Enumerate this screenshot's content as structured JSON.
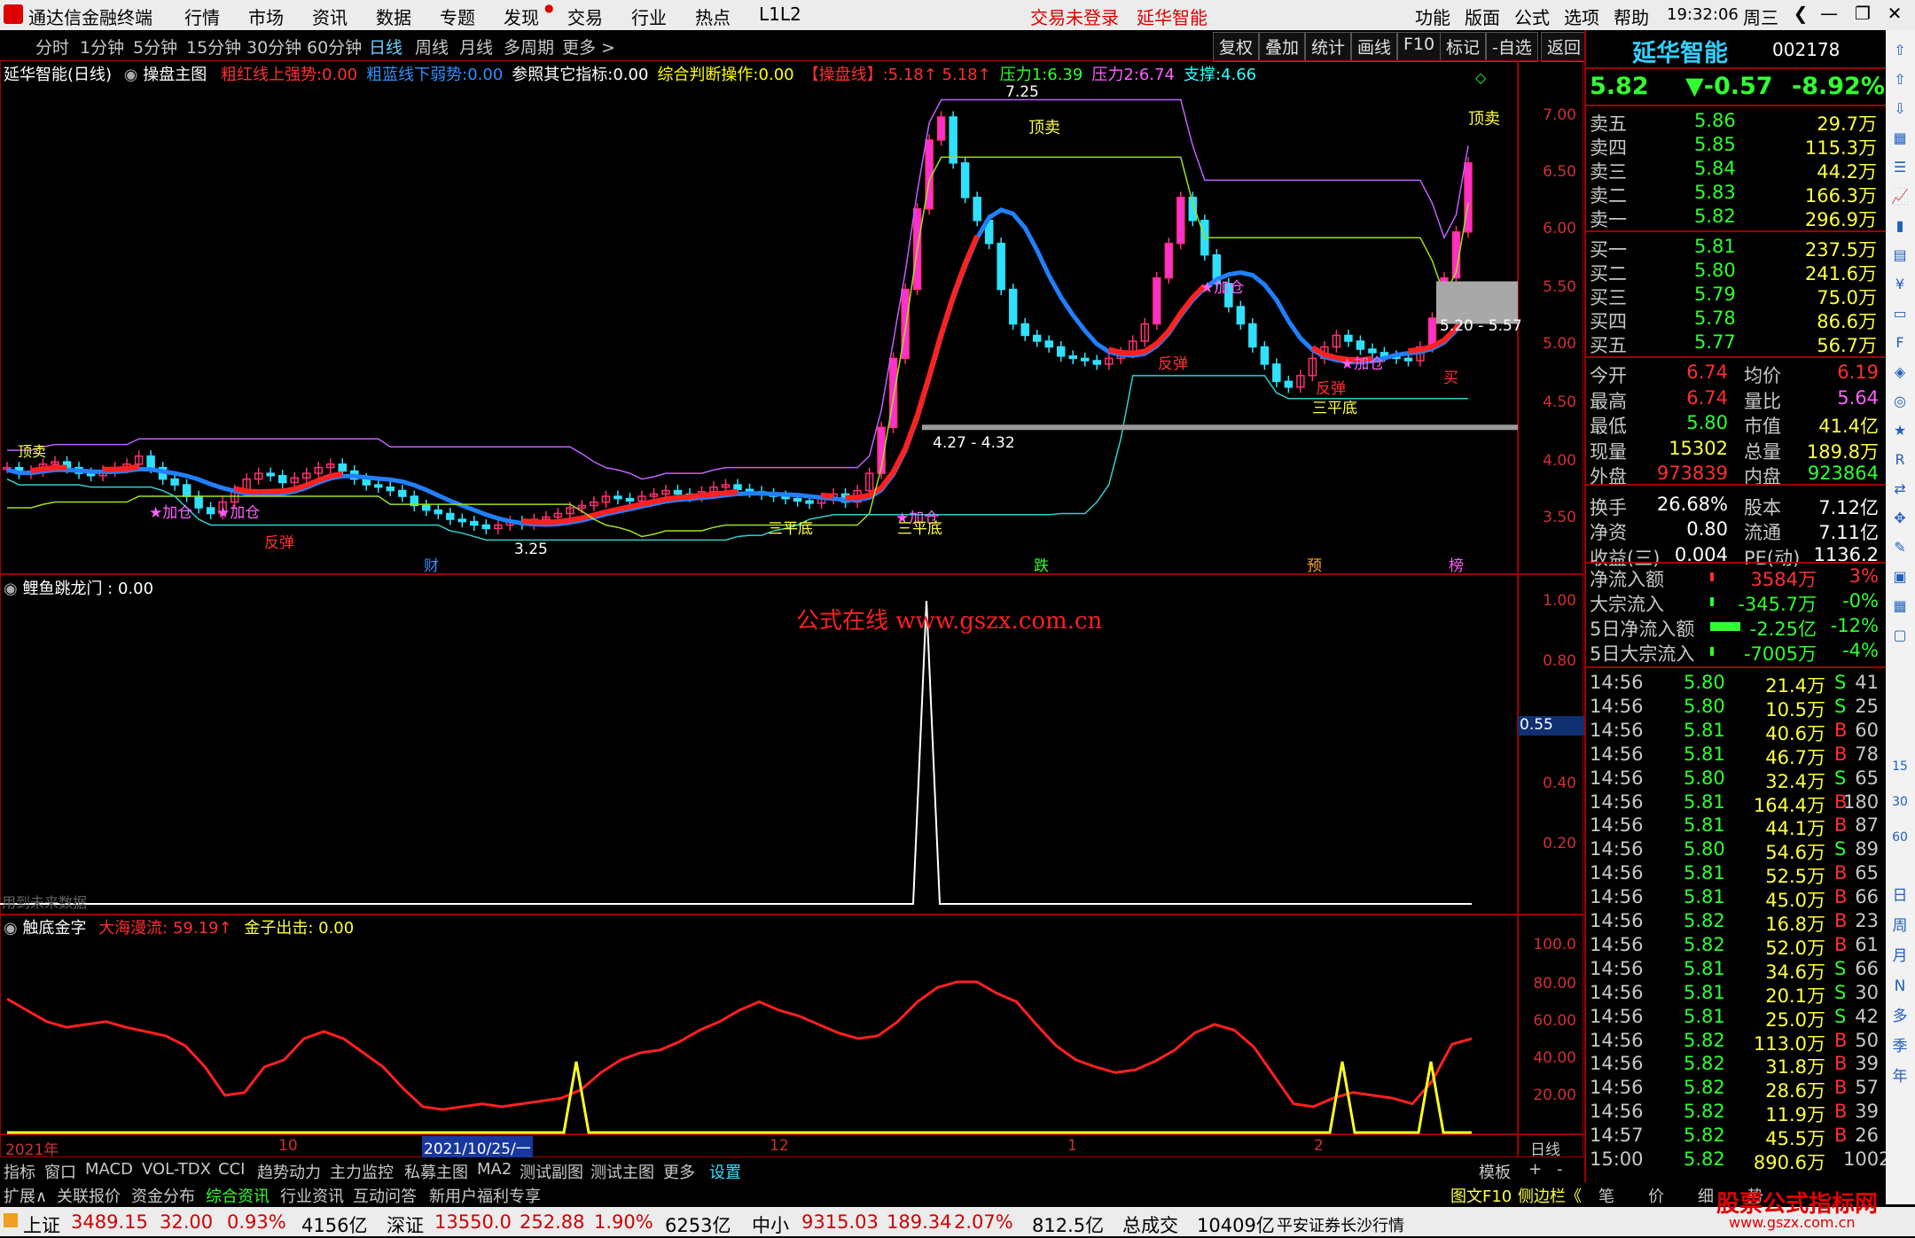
{
  "menubar": {
    "app_title": "通达信金融终端",
    "items": [
      "行情",
      "市场",
      "资讯",
      "数据",
      "专题",
      "发现",
      "交易",
      "行业",
      "热点",
      "L1L2"
    ],
    "login_status": "交易未登录",
    "stock_name": "延华智能",
    "right_items": [
      "功能",
      "版面",
      "公式",
      "选项",
      "帮助"
    ],
    "time": "19:32:06",
    "weekday": "周三"
  },
  "toolbar": {
    "periods": [
      "分时",
      "1分钟",
      "5分钟",
      "15分钟",
      "30分钟",
      "60分钟",
      "日线",
      "周线",
      "月线",
      "多周期",
      "更多 >"
    ],
    "selected": "日线",
    "right_buttons": [
      "复权",
      "叠加",
      "统计",
      "画线",
      "F10",
      "标记",
      "-自选",
      "返回"
    ]
  },
  "main_chart": {
    "name": "延华智能(日线)",
    "indicator": "操盘主图",
    "params": [
      {
        "label": "粗红线上强势:",
        "value": "0.00",
        "color": "#ff3030"
      },
      {
        "label": "粗蓝线下弱势:",
        "value": "0.00",
        "color": "#3090ff"
      },
      {
        "label": "参照其它指标:",
        "value": "0.00",
        "color": "#ffffff"
      },
      {
        "label": "综合判断操作:",
        "value": "0.00",
        "color": "#ffff00"
      },
      {
        "label": "【操盘线】:",
        "value": "5.18↑ 5.18↑",
        "color": "#ff3030"
      },
      {
        "label": "压力1:",
        "value": "6.39",
        "color": "#30ff30"
      },
      {
        "label": "压力2:",
        "value": "6.74",
        "color": "#ff60ff"
      },
      {
        "label": "支撑:",
        "value": "4.66",
        "color": "#30ffff"
      }
    ],
    "yticks": [
      "7.00",
      "6.50",
      "6.00",
      "5.50",
      "5.00",
      "4.50",
      "4.00",
      "3.50"
    ],
    "annotations": {
      "high": "7.25",
      "low": "3.25",
      "range1": "4.27 - 4.32",
      "range2": "5.20 - 5.57",
      "top_sell": "顶卖",
      "top_sell2": "顶卖",
      "add1": "★加仓",
      "add2": "★加仓",
      "add3": "★加仓",
      "add4": "★加仓",
      "add5": "★加仓",
      "bounce1": "反弹",
      "bounce2": "反弹",
      "bounce3": "反弹",
      "flat1": "三平底",
      "flat2": "三平底",
      "flat3": "三平底",
      "buy": "买",
      "sell_left": "顶卖",
      "m_cai": "财",
      "m_die": "跌",
      "m_yu": "预",
      "m_bang": "榜"
    }
  },
  "sub1": {
    "name": "鲤鱼跳龙门 : 0.00",
    "watermark": "公式在线  www.gszx.com.cn",
    "yticks": [
      "1.00",
      "0.80",
      "0.40",
      "0.20"
    ],
    "cur_value": "0.55",
    "future_note": "用到未来数据"
  },
  "sub2": {
    "name": "触底金字",
    "p1": "大海漫流: 59.19↑",
    "p2": "金子出击: 0.00",
    "yticks": [
      "100.0",
      "80.00",
      "60.00",
      "40.00",
      "20.00"
    ],
    "xlabels": [
      "2021年",
      "10",
      "2021/10/25/一",
      "12",
      "1",
      "2"
    ],
    "period": "日线"
  },
  "quote": {
    "name": "延华智能",
    "code": "002178",
    "price": "5.82",
    "change": "▼-0.57",
    "pct": "-8.92%",
    "asks": [
      [
        "卖五",
        "5.86",
        "29.7万"
      ],
      [
        "卖四",
        "5.85",
        "115.3万"
      ],
      [
        "卖三",
        "5.84",
        "44.2万"
      ],
      [
        "卖二",
        "5.83",
        "166.3万"
      ],
      [
        "卖一",
        "5.82",
        "296.9万"
      ]
    ],
    "bids": [
      [
        "买一",
        "5.81",
        "237.5万"
      ],
      [
        "买二",
        "5.80",
        "241.6万"
      ],
      [
        "买三",
        "5.79",
        "75.0万"
      ],
      [
        "买四",
        "5.78",
        "86.6万"
      ],
      [
        "买五",
        "5.77",
        "56.7万"
      ]
    ],
    "stats": [
      [
        "今开",
        "6.74",
        "均价",
        "6.19"
      ],
      [
        "最高",
        "6.74",
        "量比",
        "5.64"
      ],
      [
        "最低",
        "5.80",
        "市值",
        "41.4亿"
      ],
      [
        "现量",
        "15302",
        "总量",
        "189.8万"
      ],
      [
        "外盘",
        "973839",
        "内盘",
        "923864"
      ],
      [
        "换手",
        "26.68%",
        "股本",
        "7.12亿"
      ],
      [
        "净资",
        "0.80",
        "流通",
        "7.11亿"
      ],
      [
        "收益(三)",
        "0.004",
        "PE(动)",
        "1136.2"
      ]
    ],
    "flows": [
      [
        "净流入额",
        "3584万",
        "3%"
      ],
      [
        "大宗流入",
        "-345.7万",
        "-0%"
      ],
      [
        "5日净流入额",
        "-2.25亿",
        "-12%"
      ],
      [
        "5日大宗流入",
        "-7005万",
        "-4%"
      ]
    ],
    "ticks": [
      [
        "14:56",
        "5.80",
        "21.4万",
        "S",
        "41"
      ],
      [
        "14:56",
        "5.80",
        "10.5万",
        "S",
        "25"
      ],
      [
        "14:56",
        "5.81",
        "40.6万",
        "B",
        "60"
      ],
      [
        "14:56",
        "5.81",
        "46.7万",
        "B",
        "78"
      ],
      [
        "14:56",
        "5.80",
        "32.4万",
        "S",
        "65"
      ],
      [
        "14:56",
        "5.81",
        "164.4万",
        "B",
        "180"
      ],
      [
        "14:56",
        "5.81",
        "44.1万",
        "B",
        "87"
      ],
      [
        "14:56",
        "5.80",
        "54.6万",
        "S",
        "89"
      ],
      [
        "14:56",
        "5.81",
        "52.5万",
        "B",
        "65"
      ],
      [
        "14:56",
        "5.81",
        "45.0万",
        "B",
        "66"
      ],
      [
        "14:56",
        "5.82",
        "16.8万",
        "B",
        "23"
      ],
      [
        "14:56",
        "5.82",
        "52.0万",
        "B",
        "61"
      ],
      [
        "14:56",
        "5.81",
        "34.6万",
        "S",
        "66"
      ],
      [
        "14:56",
        "5.81",
        "20.1万",
        "S",
        "30"
      ],
      [
        "14:56",
        "5.81",
        "25.0万",
        "S",
        "42"
      ],
      [
        "14:56",
        "5.82",
        "113.0万",
        "B",
        "50"
      ],
      [
        "14:56",
        "5.82",
        "31.8万",
        "B",
        "39"
      ],
      [
        "14:56",
        "5.82",
        "28.6万",
        "B",
        "57"
      ],
      [
        "14:56",
        "5.82",
        "11.9万",
        "B",
        "39"
      ],
      [
        "14:57",
        "5.82",
        "45.5万",
        "B",
        "26"
      ],
      [
        "15:00",
        "5.82",
        "890.6万",
        "",
        "1002"
      ]
    ]
  },
  "tabbar": {
    "items": [
      "指标",
      "窗口",
      "MACD",
      "VOL-TDX",
      "CCI",
      "趋势动力",
      "主力监控",
      "私募主图",
      "MA2",
      "测试副图",
      "测试主图",
      "更多",
      "设置"
    ],
    "right": [
      "模板",
      "+",
      "-"
    ]
  },
  "extbar": {
    "items": [
      "扩展∧",
      "关联报价",
      "资金分布",
      "综合资讯",
      "行业资讯",
      "互动问答",
      "新用户福利专享"
    ],
    "right": [
      "图文F10",
      "侧边栏《"
    ],
    "rp_tabs": [
      "笔",
      "价",
      "细",
      "势"
    ]
  },
  "statusbar": {
    "sh_label": "上证",
    "sh": "3489.15",
    "sh_chg": "32.00",
    "sh_pct": "0.93%",
    "sh_amt": "4156亿",
    "sz_label": "深证",
    "sz": "13550.0",
    "sz_chg": "252.88",
    "sz_pct": "1.90%",
    "sz_amt": "6253亿",
    "zx_label": "中小",
    "zx": "9315.03",
    "zx_chg": "189.34",
    "zx_pct": "2.07%",
    "zx_amt": "812.5亿",
    "total_label": "总成交",
    "total": "10409亿",
    "broker": "平安证券长沙行情",
    "brand": "股票公式指标网",
    "brand_url": "www.gszx.com.cn"
  },
  "sideicons": {
    "labels": [
      "日",
      "周",
      "月",
      "N",
      "多",
      "季",
      "年"
    ]
  }
}
